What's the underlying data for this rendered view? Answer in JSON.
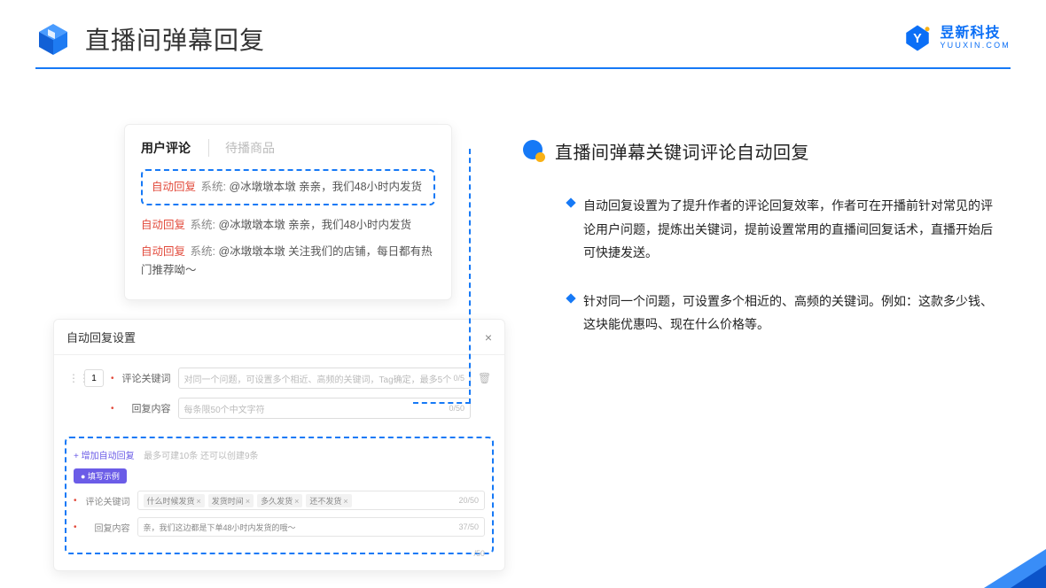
{
  "header": {
    "title": "直播间弹幕回复"
  },
  "brand": {
    "cn": "昱新科技",
    "en": "YUUXIN.COM"
  },
  "comments": {
    "tab_active": "用户评论",
    "tab_inactive": "待播商品",
    "hl_tag": "自动回复",
    "hl_sys": "系统:",
    "hl_body": "@冰墩墩本墩 亲亲，我们48小时内发货",
    "line2_tag": "自动回复",
    "line2_sys": "系统:",
    "line2_body": "@冰墩墩本墩 亲亲，我们48小时内发货",
    "line3_tag": "自动回复",
    "line3_sys": "系统:",
    "line3_body": "@冰墩墩本墩 关注我们的店铺，每日都有热门推荐呦～"
  },
  "settings": {
    "title": "自动回复设置",
    "close": "×",
    "num": "1",
    "kw_label": "评论关键词",
    "kw_placeholder": "对同一个问题，可设置多个相近、高频的关键词，Tag确定，最多5个",
    "kw_count": "0/5",
    "content_label": "回复内容",
    "content_placeholder": "每条限50个中文字符",
    "content_count": "0/50",
    "add_link": "+ 增加自动回复",
    "add_note": "最多可建10条 还可以创建9条",
    "example_badge": "● 填写示例",
    "ex_kw_label": "评论关键词",
    "ex_chips": [
      "什么时候发货",
      "发货时间",
      "多久发货",
      "还不发货"
    ],
    "ex_kw_count": "20/50",
    "ex_content_label": "回复内容",
    "ex_content_text": "亲，我们这边都是下单48小时内发货的哦～",
    "ex_content_count": "37/50",
    "stray": "/50"
  },
  "right": {
    "subtitle": "直播间弹幕关键词评论自动回复",
    "b1": "自动回复设置为了提升作者的评论回复效率，作者可在开播前针对常见的评论用户问题，提炼出关键词，提前设置常用的直播间回复话术，直播开始后可快捷发送。",
    "b2": "针对同一个问题，可设置多个相近的、高频的关键词。例如：这款多少钱、这块能优惠吗、现在什么价格等。"
  }
}
